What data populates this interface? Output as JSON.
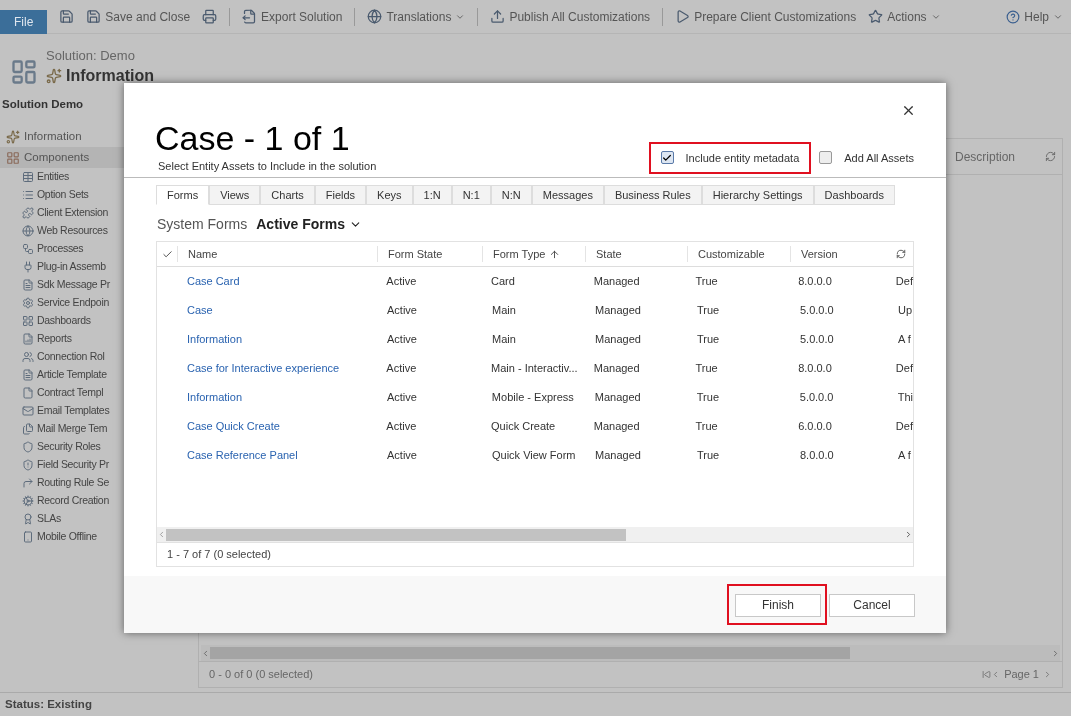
{
  "toolbar": {
    "file_tab": "File",
    "items": [
      {
        "kind": "icon"
      },
      {
        "kind": "button",
        "label": "Save and Close",
        "has_menu": false
      },
      {
        "kind": "icon"
      },
      {
        "kind": "button",
        "label": "Export Solution",
        "has_menu": false
      },
      {
        "kind": "button",
        "label": "Translations",
        "has_menu": true
      },
      {
        "kind": "button",
        "label": "Publish All Customizations",
        "has_menu": false
      },
      {
        "kind": "button",
        "label": "Prepare Client Customizations",
        "has_menu": false
      },
      {
        "kind": "button",
        "label": "Actions",
        "has_menu": true
      }
    ],
    "help": {
      "label": "Help",
      "has_menu": true
    }
  },
  "header": {
    "solution": "Solution: Demo",
    "title": "Information"
  },
  "sidebar": {
    "heading": "Solution Demo",
    "items": [
      {
        "label": "Information",
        "selected": false
      },
      {
        "label": "Components",
        "selected": true,
        "children": [
          {
            "label": "Entities"
          },
          {
            "label": "Option Sets"
          },
          {
            "label": "Client Extension"
          },
          {
            "label": "Web Resources"
          },
          {
            "label": "Processes"
          },
          {
            "label": "Plug-in Assemb"
          },
          {
            "label": "Sdk Message Pr"
          },
          {
            "label": "Service Endpoin"
          },
          {
            "label": "Dashboards"
          },
          {
            "label": "Reports"
          },
          {
            "label": "Connection Rol"
          },
          {
            "label": "Article Template"
          },
          {
            "label": "Contract Templ"
          },
          {
            "label": "Email Templates"
          },
          {
            "label": "Mail Merge Tem"
          },
          {
            "label": "Security Roles"
          },
          {
            "label": "Field Security Pr"
          },
          {
            "label": "Routing Rule Se"
          },
          {
            "label": "Record Creation"
          },
          {
            "label": "SLAs"
          },
          {
            "label": "Mobile Offline"
          }
        ]
      }
    ]
  },
  "background_grid": {
    "column": "Description",
    "count": "0 - 0 of 0 (0 selected)",
    "page": "Page 1"
  },
  "status_bar": "Status: Existing",
  "dialog": {
    "title": "Case - 1 of 1",
    "subtitle": "Select Entity Assets to Include in the solution",
    "options": [
      {
        "label": "Include entity metadata",
        "checked": true,
        "highlighted": true
      },
      {
        "label": "Add All Assets",
        "checked": false,
        "highlighted": false
      }
    ],
    "tabs": [
      {
        "label": "Forms",
        "selected": true
      },
      {
        "label": "Views",
        "selected": false
      },
      {
        "label": "Charts",
        "selected": false
      },
      {
        "label": "Fields",
        "selected": false
      },
      {
        "label": "Keys",
        "selected": false
      },
      {
        "label": "1:N",
        "selected": false
      },
      {
        "label": "N:1",
        "selected": false
      },
      {
        "label": "N:N",
        "selected": false
      },
      {
        "label": "Messages",
        "selected": false
      },
      {
        "label": "Business Rules",
        "selected": false
      },
      {
        "label": "Hierarchy Settings",
        "selected": false
      },
      {
        "label": "Dashboards",
        "selected": false
      }
    ],
    "view_label": "System Forms",
    "view": "Active Forms",
    "columns": [
      {
        "label": "Name",
        "sorted": false
      },
      {
        "label": "Form State",
        "sorted": false
      },
      {
        "label": "Form Type",
        "sorted": true
      },
      {
        "label": "State",
        "sorted": false
      },
      {
        "label": "Customizable",
        "sorted": false
      },
      {
        "label": "Version",
        "sorted": false
      }
    ],
    "rows": [
      [
        "Case Card",
        "Active",
        "Card",
        "Managed",
        "True",
        "8.0.0.0",
        "Def"
      ],
      [
        "Case",
        "Active",
        "Main",
        "Managed",
        "True",
        "5.0.0.0",
        "Up"
      ],
      [
        "Information",
        "Active",
        "Main",
        "Managed",
        "True",
        "5.0.0.0",
        "A f"
      ],
      [
        "Case for Interactive experience",
        "Active",
        "Main - Interactiv...",
        "Managed",
        "True",
        "8.0.0.0",
        "Def"
      ],
      [
        "Information",
        "Active",
        "Mobile - Express",
        "Managed",
        "True",
        "5.0.0.0",
        "Thi"
      ],
      [
        "Case Quick Create",
        "Active",
        "Quick Create",
        "Managed",
        "True",
        "6.0.0.0",
        "Def"
      ],
      [
        "Case Reference Panel",
        "Active",
        "Quick View Form",
        "Managed",
        "True",
        "8.0.0.0",
        "A f"
      ]
    ],
    "count": "1 - 7 of 7 (0 selected)",
    "buttons": [
      {
        "label": "Finish",
        "highlighted": true
      },
      {
        "label": "Cancel",
        "highlighted": false
      }
    ]
  }
}
